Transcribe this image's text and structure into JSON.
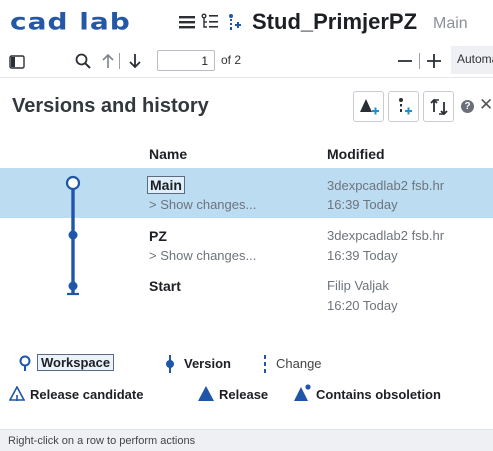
{
  "app": {
    "logo_text": "cad lab",
    "document_title": "Stud_PrimjerPZ",
    "branch": "Main"
  },
  "toolbar": {
    "page_value": "1",
    "page_of": "of 2",
    "zoom_label": "Automa"
  },
  "panel": {
    "title": "Versions and history",
    "columns": {
      "name": "Name",
      "modified": "Modified"
    },
    "rows": [
      {
        "name": "Main",
        "changes": "> Show changes...",
        "modified_by": "3dexpcadlab2 fsb.hr",
        "modified_at": "16:39 Today",
        "kind": "workspace",
        "selected": true
      },
      {
        "name": "PZ",
        "changes": "> Show changes...",
        "modified_by": "3dexpcadlab2 fsb.hr",
        "modified_at": "16:39 Today",
        "kind": "version",
        "selected": false
      },
      {
        "name": "Start",
        "changes": "",
        "modified_by": "Filip Valjak",
        "modified_at": "16:20 Today",
        "kind": "start",
        "selected": false
      }
    ]
  },
  "legend": {
    "workspace": "Workspace",
    "version": "Version",
    "change": "Change",
    "release_candidate": "Release candidate",
    "release": "Release",
    "contains_obsoletion": "Contains obsoletion"
  },
  "status": {
    "text": "Right-click on a row to perform actions"
  },
  "colors": {
    "brand": "#2457a6",
    "selected_row": "#bcdcf2",
    "graph": "#1f56a8"
  }
}
